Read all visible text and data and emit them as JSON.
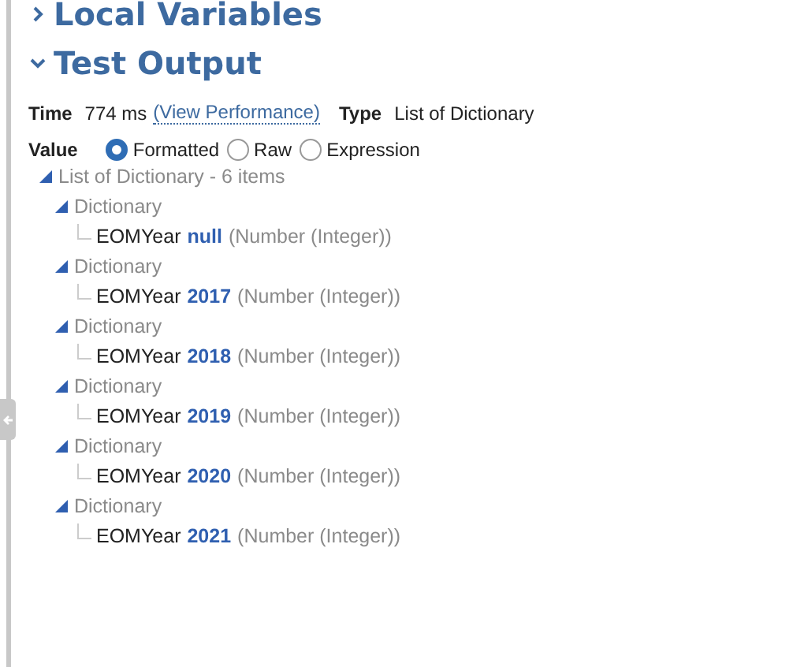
{
  "sections": [
    {
      "title": "Local Variables",
      "expanded": false
    },
    {
      "title": "Test Output",
      "expanded": true
    }
  ],
  "info": {
    "time_label": "Time",
    "time_value": "774 ms",
    "performance_link": "(View Performance)",
    "type_label": "Type",
    "type_value": "List of Dictionary"
  },
  "value": {
    "label": "Value",
    "options": [
      {
        "label": "Formatted",
        "selected": true
      },
      {
        "label": "Raw",
        "selected": false
      },
      {
        "label": "Expression",
        "selected": false
      }
    ]
  },
  "tree": {
    "label": "List of Dictionary - 6 items",
    "expanded": true,
    "children": [
      {
        "label": "Dictionary",
        "expanded": true,
        "children": [
          {
            "name": "EOMYear",
            "value": "null",
            "type": "(Number (Integer))"
          }
        ]
      },
      {
        "label": "Dictionary",
        "expanded": true,
        "children": [
          {
            "name": "EOMYear",
            "value": "2017",
            "type": "(Number (Integer))"
          }
        ]
      },
      {
        "label": "Dictionary",
        "expanded": true,
        "children": [
          {
            "name": "EOMYear",
            "value": "2018",
            "type": "(Number (Integer))"
          }
        ]
      },
      {
        "label": "Dictionary",
        "expanded": true,
        "children": [
          {
            "name": "EOMYear",
            "value": "2019",
            "type": "(Number (Integer))"
          }
        ]
      },
      {
        "label": "Dictionary",
        "expanded": true,
        "children": [
          {
            "name": "EOMYear",
            "value": "2020",
            "type": "(Number (Integer))"
          }
        ]
      },
      {
        "label": "Dictionary",
        "expanded": true,
        "children": [
          {
            "name": "EOMYear",
            "value": "2021",
            "type": "(Number (Integer))"
          }
        ]
      }
    ]
  }
}
